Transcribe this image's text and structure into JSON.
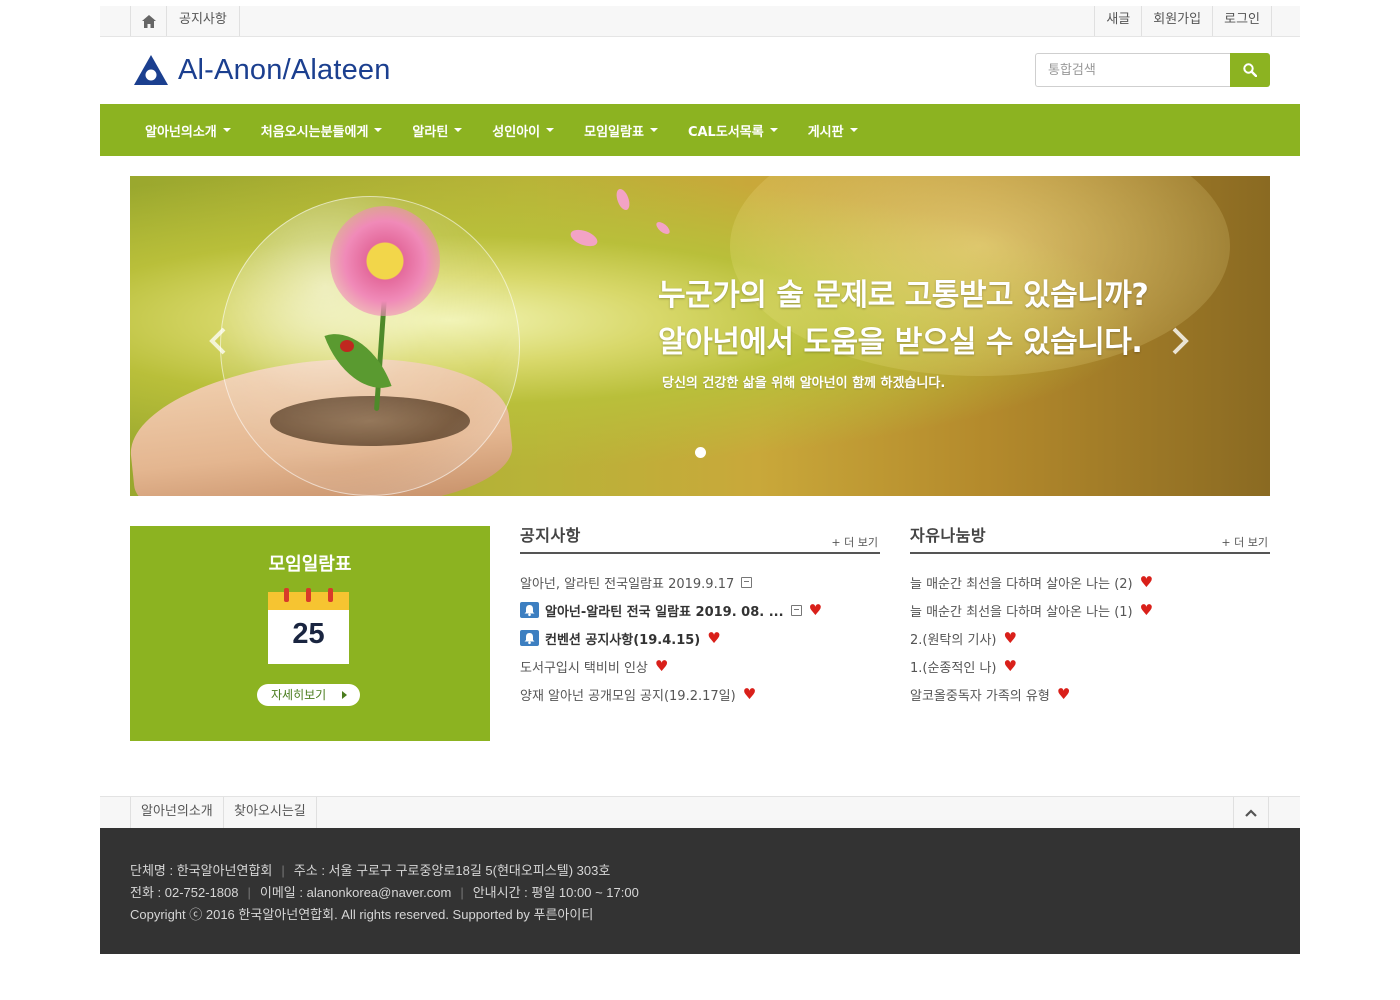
{
  "topbar": {
    "home_icon": "home-icon",
    "notice": "공지사항",
    "links": [
      "새글",
      "회원가입",
      "로그인"
    ]
  },
  "header": {
    "logo_text": "Al-Anon/Alateen",
    "search_placeholder": "통합검색",
    "search_icon": "search-icon",
    "brand_color": "#8cb321"
  },
  "nav": {
    "items": [
      "알아넌의소개",
      "처음오시는분들에게",
      "알라틴",
      "성인아이",
      "모임일람표",
      "CAL도서목록",
      "게시판"
    ]
  },
  "hero": {
    "line1": "누군가의 술 문제로 고통받고 있습니까?",
    "line2": "알아넌에서 도움을 받으실 수 있습니다.",
    "sub": "당신의 건강한 삶을 위해 알아넌이 함께 하겠습니다."
  },
  "schedule": {
    "title": "모임일람표",
    "calendar_day": "25",
    "more": "자세히보기"
  },
  "notice_board": {
    "title": "공지사항",
    "more": "+ 더 보기",
    "items": [
      {
        "text": "알아넌, 알라틴 전국일람표 2019.9.17",
        "file": true,
        "heart": false,
        "badge": false,
        "bold": false
      },
      {
        "text": "알아넌-알라틴 전국 일람표 2019. 08. ...",
        "file": true,
        "heart": true,
        "badge": true,
        "bold": true
      },
      {
        "text": "컨벤션 공지사항(19.4.15)",
        "file": false,
        "heart": true,
        "badge": true,
        "bold": true
      },
      {
        "text": "도서구입시 택비비 인상",
        "file": false,
        "heart": true,
        "badge": false,
        "bold": false
      },
      {
        "text": "양재 알아넌 공개모임 공지(19.2.17일)",
        "file": false,
        "heart": true,
        "badge": false,
        "bold": false
      }
    ]
  },
  "free_board": {
    "title": "자유나눔방",
    "more": "+ 더 보기",
    "items": [
      {
        "text": "늘 매순간 최선을 다하며 살아온 나는 (2)",
        "heart": true
      },
      {
        "text": "늘 매순간 최선을 다하며 살아온 나는 (1)",
        "heart": true
      },
      {
        "text": "2.(원탁의 기사)",
        "heart": true
      },
      {
        "text": "1.(순종적인 나)",
        "heart": true
      },
      {
        "text": "알코올중독자 가족의 유형",
        "heart": true
      }
    ]
  },
  "footer": {
    "links": [
      "알아넌의소개",
      "찾아오시는길"
    ],
    "org": "단체명 : 한국알아넌연합회",
    "address": "주소 : 서울 구로구 구로중앙로18길 5(현대오피스텔) 303호",
    "phone": "전화 : 02-752-1808",
    "email": "이메일 : alanonkorea@naver.com",
    "hours": "안내시간 : 평일 10:00 ~ 17:00",
    "copyright": "Copyright ⓒ 2016 한국알아넌연합회. All rights reserved. Supported by 푸른아이티"
  }
}
